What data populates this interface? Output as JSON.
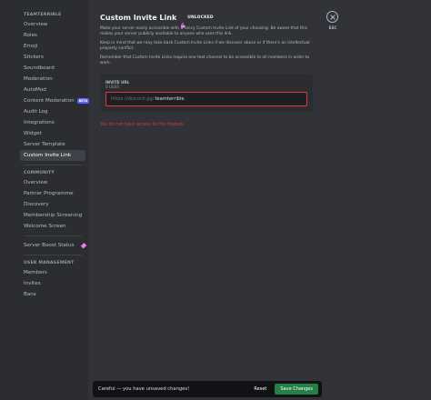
{
  "colors": {
    "background": "#313338",
    "sidebar": "#2b2d31",
    "accent_beta": "#5865f2",
    "boost": "#ff73fa",
    "error": "#da373c",
    "save": "#248046"
  },
  "sidebar": {
    "server_header": "TEAMTERRIBLE",
    "server_items": [
      {
        "label": "Overview"
      },
      {
        "label": "Roles"
      },
      {
        "label": "Emoji"
      },
      {
        "label": "Stickers"
      },
      {
        "label": "Soundboard"
      },
      {
        "label": "Moderation"
      },
      {
        "label": "AutoMod"
      },
      {
        "label": "Content Moderation",
        "badge": "BETA"
      },
      {
        "label": "Audit Log"
      },
      {
        "label": "Integrations"
      },
      {
        "label": "Widget"
      },
      {
        "label": "Server Template"
      },
      {
        "label": "Custom Invite Link",
        "active": true
      }
    ],
    "community_header": "COMMUNITY",
    "community_items": [
      {
        "label": "Overview"
      },
      {
        "label": "Partner Programme"
      },
      {
        "label": "Discovery"
      },
      {
        "label": "Membership Screening"
      },
      {
        "label": "Welcome Screen"
      }
    ],
    "boost_item": {
      "label": "Server Boost Status",
      "icon": "boost-gem-icon"
    },
    "user_mgmt_header": "USER MANAGEMENT",
    "user_mgmt_items": [
      {
        "label": "Members"
      },
      {
        "label": "Invites"
      },
      {
        "label": "Bans"
      }
    ]
  },
  "main": {
    "title": "Custom Invite Link",
    "unlocked_label": "UNLOCKED",
    "unlocked_icon": "unlock-icon",
    "para1": "Make your server easily accessible with a fancy Custom Invite Link of your choosing. Be aware that this makes your server publicly available to anyone who uses this link.",
    "para2": "Keep in mind that we may take back Custom Invite Links if we discover abuse or if there's an intellectual property conflict.",
    "para3": "Remember that Custom Invite Links require one text channel to be accessible to all members in order to work.",
    "invite": {
      "label": "INVITE URL",
      "uses": "0 USES",
      "prefix": "https://discord.gg/",
      "value": "teamterrible"
    },
    "error": "You do not have access to this feature."
  },
  "close": {
    "icon": "close-icon",
    "label": "ESC"
  },
  "save_bar": {
    "message": "Careful — you have unsaved changes!",
    "reset": "Reset",
    "save": "Save Changes"
  }
}
